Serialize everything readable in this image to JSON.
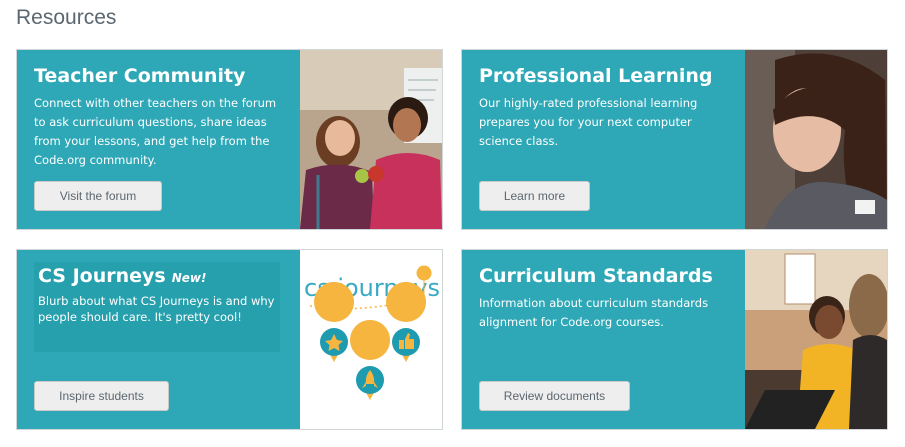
{
  "section_title": "Resources",
  "cards": [
    {
      "title": "Teacher Community",
      "description": "Connect with other teachers on the forum to ask curriculum questions, share ideas from your lessons, and get help from the Code.org community.",
      "button": "Visit the forum",
      "image": "teachers-photo"
    },
    {
      "title": "Professional Learning",
      "description": "Our highly-rated professional learning prepares you for your next computer science class.",
      "button": "Learn more",
      "image": "learner-photo"
    },
    {
      "title": "CS Journeys",
      "badge": "New!",
      "description": "Blurb about what CS Journeys is and why people should care. It's pretty cool!",
      "button": "Inspire students",
      "image": "cs-journeys-logo",
      "logo_text": "cs journeys"
    },
    {
      "title": "Curriculum Standards",
      "description": "Information about curriculum standards alignment for Code.org courses.",
      "button": "Review documents",
      "image": "students-photo"
    }
  ],
  "colors": {
    "teal": "#2ea8b6",
    "button_bg": "#eeeeee",
    "button_text": "#5b6770",
    "heading_gray": "#5b6770",
    "journeys_yellow": "#f6b53f"
  }
}
